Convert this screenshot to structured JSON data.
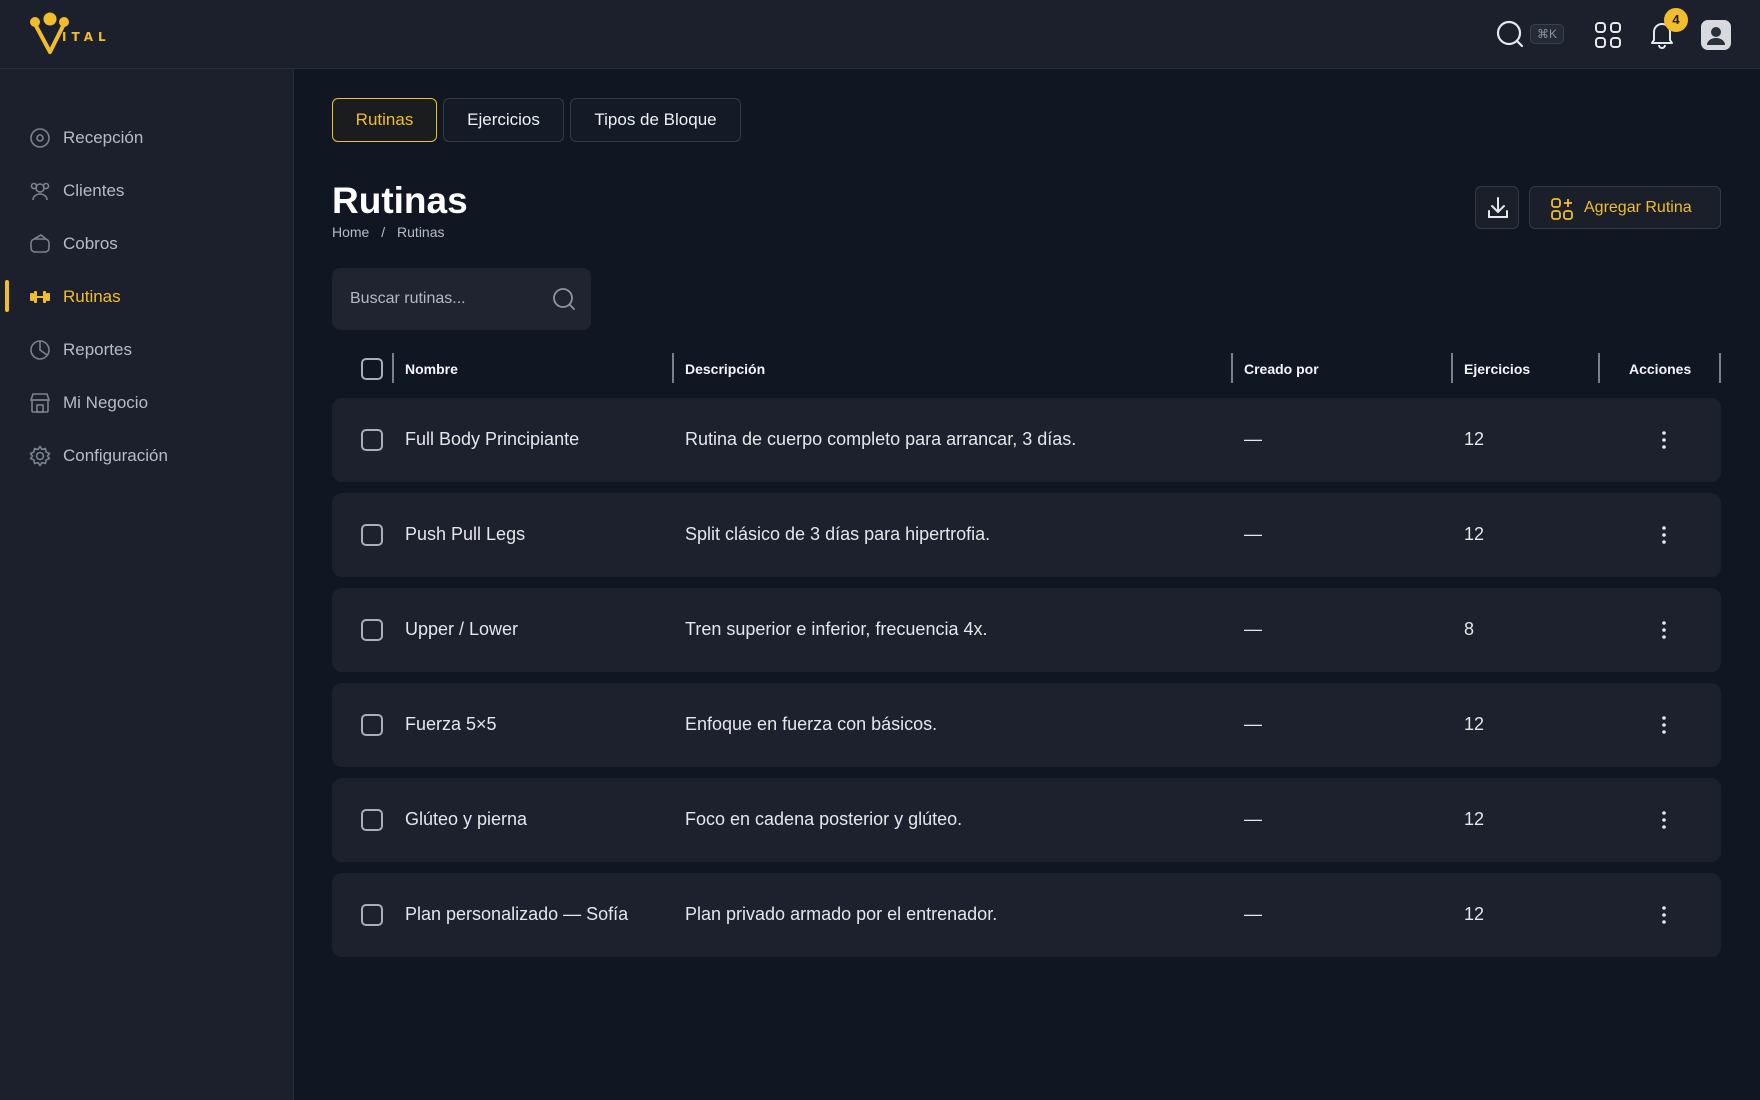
{
  "app": {
    "logo_text": "ITAL",
    "accent": "#f2bd2c"
  },
  "topbar": {
    "shortcut": "⌘K",
    "notifications_count": "4"
  },
  "sidebar": {
    "items": [
      {
        "label": "Recepción",
        "icon": "reception-icon"
      },
      {
        "label": "Clientes",
        "icon": "users-icon"
      },
      {
        "label": "Cobros",
        "icon": "wallet-icon"
      },
      {
        "label": "Rutinas",
        "icon": "dumbbell-icon",
        "active": true
      },
      {
        "label": "Reportes",
        "icon": "pie-chart-icon"
      },
      {
        "label": "Mi Negocio",
        "icon": "store-icon"
      },
      {
        "label": "Configuración",
        "icon": "gear-icon"
      }
    ]
  },
  "tabs": [
    {
      "label": "Rutinas",
      "active": true
    },
    {
      "label": "Ejercicios"
    },
    {
      "label": "Tipos de Bloque"
    }
  ],
  "page": {
    "title": "Rutinas",
    "breadcrumb": [
      "Home",
      "/",
      "Rutinas"
    ],
    "add_button": "Agregar Rutina"
  },
  "search": {
    "placeholder": "Buscar rutinas..."
  },
  "table": {
    "columns": [
      "Nombre",
      "Descripción",
      "Creado por",
      "Ejercicios",
      "Acciones"
    ],
    "rows": [
      {
        "nombre": "Full Body Principiante",
        "descripcion": "Rutina de cuerpo completo para arrancar, 3 días.",
        "creado_por": "—",
        "ejercicios": "12"
      },
      {
        "nombre": "Push Pull Legs",
        "descripcion": "Split clásico de 3 días para hipertrofia.",
        "creado_por": "—",
        "ejercicios": "12"
      },
      {
        "nombre": "Upper / Lower",
        "descripcion": "Tren superior e inferior, frecuencia 4x.",
        "creado_por": "—",
        "ejercicios": "8"
      },
      {
        "nombre": "Fuerza 5×5",
        "descripcion": "Enfoque en fuerza con básicos.",
        "creado_por": "—",
        "ejercicios": "12"
      },
      {
        "nombre": "Glúteo y pierna",
        "descripcion": "Foco en cadena posterior y glúteo.",
        "creado_por": "—",
        "ejercicios": "12"
      },
      {
        "nombre": "Plan personalizado — Sofía",
        "descripcion": "Plan privado armado por el entrenador.",
        "creado_por": "—",
        "ejercicios": "12"
      }
    ]
  }
}
